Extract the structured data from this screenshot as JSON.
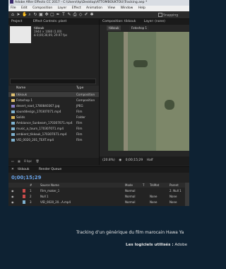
{
  "window": {
    "title": "Adobe After Effects CC 2017 - C:\\Users\\hp\\Desktop\\ATTOMBOUKTOU\\Tracking.aep *"
  },
  "menu": [
    "File",
    "Edit",
    "Composition",
    "Layer",
    "Effect",
    "Animation",
    "View",
    "Window",
    "Help"
  ],
  "toolbar": {
    "snapping_label": "Snapping"
  },
  "project": {
    "tab_label": "Project",
    "effect_controls_label": "Effect Controls: plant",
    "preview_name": "tikkouk",
    "preview_info_line1": "1944 × 1080 (1.00)",
    "preview_info_line2": "Δ 0;00;36;09, 29.97 fps",
    "columns": [
      "Name",
      "Type"
    ],
    "items": [
      {
        "name": "tikkouk",
        "type": "Composition",
        "color": "#e0c070",
        "selected": true
      },
      {
        "name": "Fotoshop 1",
        "type": "Composition",
        "color": "#e0c070"
      },
      {
        "name": "desert_road_1780840367.jpg",
        "type": "JPEG",
        "color": "#8a7fc8"
      },
      {
        "name": "sounddesign_170307071.mp4",
        "type": "Film",
        "color": "#7fb2d0"
      },
      {
        "name": "Solids",
        "type": "Folder",
        "color": "#d8b55a"
      },
      {
        "name": "Ambiance_Sunbeam_170307071.mp4",
        "type": "Film",
        "color": "#7fb2d0"
      },
      {
        "name": "music_a_tourn_170307071.mp4",
        "type": "Film",
        "color": "#7fb2d0"
      },
      {
        "name": "ambient_tikkouk_170307071.mp4",
        "type": "Film",
        "color": "#7fb2d0"
      },
      {
        "name": "VID_0020_201_TEXT.mp4",
        "type": "Film",
        "color": "#7fb2d0"
      }
    ],
    "bpc_label": "8 bpc"
  },
  "composition": {
    "tab_label": "Composition: tikkouk",
    "layer_tab_label": "Layer: (none)",
    "sub_tabs": [
      "tikkouk",
      "Fotoshop 1"
    ],
    "zoom": "(20.8%)",
    "timecode": "0;00;15;29",
    "resolution": "Half"
  },
  "timeline": {
    "tabs": [
      "tikkouk",
      "Render Queue"
    ],
    "current_time": "0;00;15;29",
    "columns": [
      "#",
      "Source Name",
      "Mode",
      "T",
      "TrkMat",
      "Parent"
    ],
    "layers": [
      {
        "num": "1",
        "name": "Film_maker_1",
        "mode": "Normal",
        "trkmat": "",
        "parent": "2. Null 1",
        "color": "#c94b4b"
      },
      {
        "num": "2",
        "name": "Null 1",
        "mode": "Normal",
        "trkmat": "None",
        "parent": "None",
        "color": "#c94b4b"
      },
      {
        "num": "3",
        "name": "VID_0020_20...A.mp4",
        "mode": "Normal",
        "trkmat": "None",
        "parent": "None",
        "color": "#7fb2d0"
      }
    ]
  },
  "caption": {
    "line1": "Tracking d’un générique du film marocain Hawa Ya",
    "line2_bold": "Les logiciels utilisés :",
    "line2_rest": " Adobe"
  }
}
